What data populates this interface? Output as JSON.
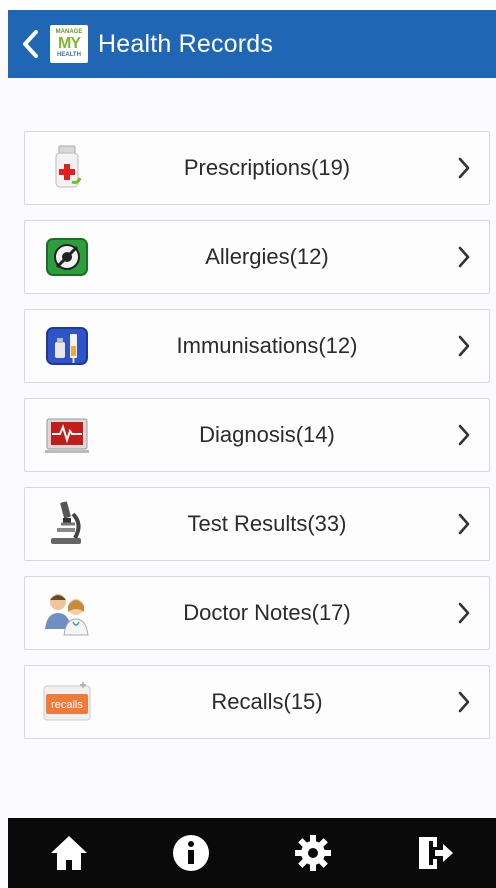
{
  "header": {
    "title": "Health Records",
    "logo": {
      "top": "MANAGE",
      "mid": "MY",
      "bottom": "HEALTH"
    }
  },
  "records": [
    {
      "label": "Prescriptions(19)",
      "icon": "prescription-bottle-icon"
    },
    {
      "label": "Allergies(12)",
      "icon": "allergy-icon"
    },
    {
      "label": "Immunisations(12)",
      "icon": "vaccine-icon"
    },
    {
      "label": "Diagnosis(14)",
      "icon": "heart-monitor-icon"
    },
    {
      "label": "Test Results(33)",
      "icon": "microscope-icon"
    },
    {
      "label": "Doctor Notes(17)",
      "icon": "doctors-icon"
    },
    {
      "label": "Recalls(15)",
      "icon": "recalls-icon",
      "icon_text": "recalls"
    }
  ],
  "footer": {
    "items": [
      "home-icon",
      "info-icon",
      "settings-icon",
      "logout-icon"
    ]
  },
  "colors": {
    "header": "#1f67b5",
    "footer": "#0a0a0a",
    "background": "#fbfbfd"
  }
}
